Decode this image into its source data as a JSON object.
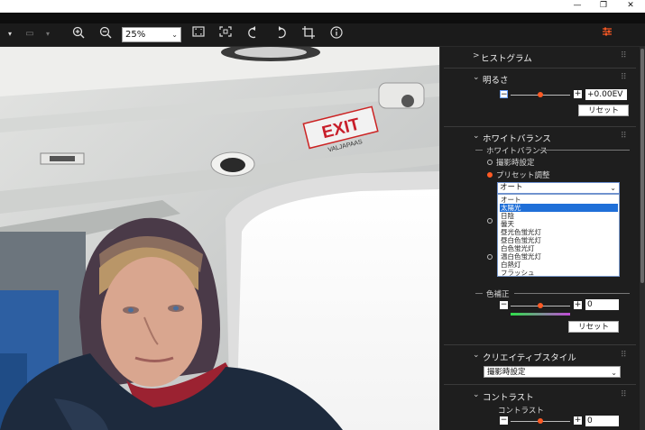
{
  "window": {
    "minimize": "—",
    "restore": "❐",
    "close": "✕"
  },
  "toolbar": {
    "zoom_value": "25%"
  },
  "photo": {
    "sign_text": "EXIT",
    "sign_sub": "VALJAPAAS"
  },
  "panel": {
    "histogram": {
      "title": "ヒストグラム"
    },
    "brightness": {
      "title": "明るさ",
      "value": "+0.00EV",
      "reset": "リセット",
      "level": 0.5
    },
    "white_balance": {
      "title": "ホワイトバランス",
      "group_label": "ホワイトバランス",
      "option_shot": "撮影時設定",
      "option_preset": "プリセット調整",
      "preset_selected": "オート",
      "preset_options": [
        "オート",
        "太陽光",
        "日陰",
        "曇天",
        "昼光色蛍光灯",
        "昼白色蛍光灯",
        "白色蛍光灯",
        "温白色蛍光灯",
        "白熱灯",
        "フラッシュ"
      ],
      "highlighted_index": 1
    },
    "color_correction": {
      "group_label": "色補正",
      "value": "0",
      "reset": "リセット",
      "level": 0.5
    },
    "creative_style": {
      "title": "クリエイティブスタイル",
      "selected": "撮影時設定"
    },
    "contrast": {
      "title": "コントラスト",
      "sub_label": "コントラスト",
      "value": "0",
      "level": 0.5
    }
  },
  "colors": {
    "accent": "#ff5a24",
    "highlight": "#1f6fd8"
  }
}
